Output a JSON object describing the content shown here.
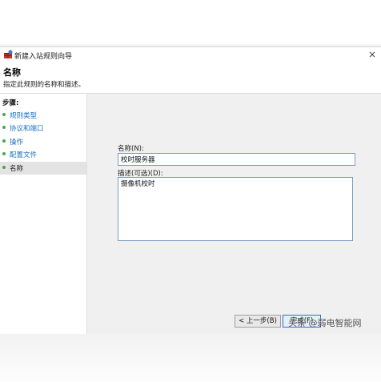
{
  "window": {
    "title": "新建入站规则向导",
    "close_glyph": "×"
  },
  "header": {
    "title": "名称",
    "subtitle": "指定此规则的名称和描述。"
  },
  "sidebar": {
    "steps_label": "步骤:",
    "items": [
      {
        "label": "规则类型",
        "active": false
      },
      {
        "label": "协议和端口",
        "active": false
      },
      {
        "label": "操作",
        "active": false
      },
      {
        "label": "配置文件",
        "active": false
      },
      {
        "label": "名称",
        "active": true
      }
    ]
  },
  "form": {
    "name_label": "名称(N):",
    "name_value": "校时服务器",
    "desc_label": "描述(可选)(D):",
    "desc_value": "摄像机校时"
  },
  "buttons": {
    "back": "< 上一步(B)",
    "next": "完成(F)"
  },
  "watermark": "头条 @弱电智能网",
  "colors": {
    "accent_link": "#1a6fc2",
    "bullet": "#4ea34e",
    "input_border": "#7a9bbf"
  }
}
